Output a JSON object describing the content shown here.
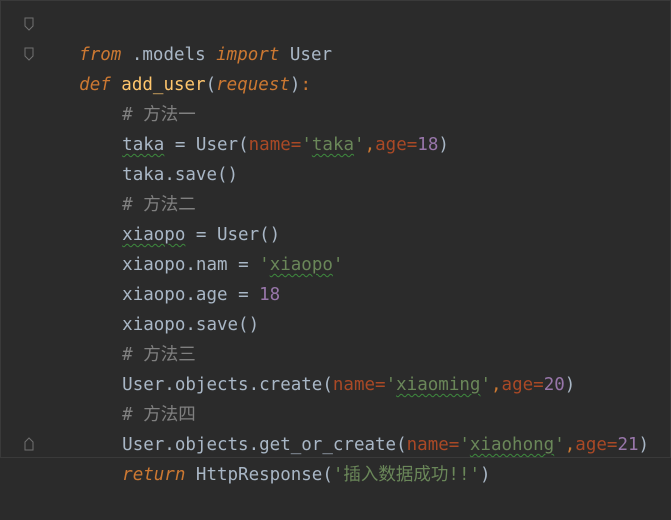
{
  "editor": {
    "lines": [
      {
        "from_kw": "from",
        "module": " .models ",
        "import_kw": "import",
        "name": " User"
      },
      {
        "def_kw": "def",
        "fn": " add_user",
        "lparen": "(",
        "param": "request",
        "rparen": ")",
        "colon": ":"
      },
      {
        "comment": "# 方法一"
      },
      {
        "var": "taka",
        "eq": " = ",
        "cls": "User",
        "lp": "(",
        "kw1": "name",
        "eq1": "=",
        "s1q1": "'",
        "s1": "taka",
        "s1q2": "'",
        "comma": ",",
        "kw2": "age",
        "eq2": "=",
        "n2": "18",
        "rp": ")"
      },
      {
        "var": "taka",
        "rest": ".save()"
      },
      {
        "comment": "# 方法二"
      },
      {
        "var": "xiaopo",
        "eq": " = ",
        "cls": "User",
        "call": "()"
      },
      {
        "var": "xiaopo",
        "attr": ".nam",
        "eq": " = ",
        "q1": "'",
        "s": "xiaopo",
        "q2": "'"
      },
      {
        "var": "xiaopo",
        "attr": ".age",
        "eq": " = ",
        "n": "18"
      },
      {
        "var": "xiaopo",
        "rest": ".save()"
      },
      {
        "comment": "# 方法三"
      },
      {
        "prefix": "User.objects.create",
        "lp": "(",
        "kw1": "name",
        "eq1": "=",
        "q1": "'",
        "s1": "xiaoming",
        "q2": "'",
        "comma": ",",
        "kw2": "age",
        "eq2": "=",
        "n2": "20",
        "rp": ")"
      },
      {
        "comment": "# 方法四"
      },
      {
        "prefix": "User.objects.get_or_create",
        "lp": "(",
        "kw1": "name",
        "eq1": "=",
        "q1": "'",
        "s1": "xiaohong",
        "q2": "'",
        "comma": ",",
        "kw2": "age",
        "eq2": "=",
        "n2": "21",
        "rp": ")"
      },
      {
        "return_kw": "return",
        "cls": " HttpResponse",
        "lp": "(",
        "str": "'插入数据成功!!'",
        "rp": ")"
      }
    ]
  },
  "colors": {
    "background": "#2b2b2b",
    "keyword": "#cc7832",
    "function": "#ffc66d",
    "string": "#6a8759",
    "number": "#9876aa",
    "comment": "#808080",
    "text": "#a9b7c6",
    "named_arg": "#aa4926"
  }
}
